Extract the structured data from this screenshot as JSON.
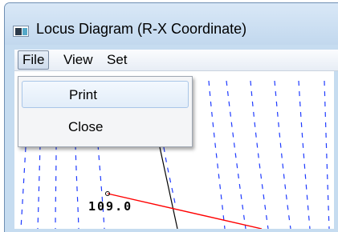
{
  "window": {
    "title": "Locus Diagram (R-X Coordinate)"
  },
  "icons": {
    "app": "app-icon"
  },
  "menubar": {
    "items": [
      {
        "label": "File",
        "active": true
      },
      {
        "label": "View",
        "active": false
      },
      {
        "label": "Set",
        "active": false
      }
    ]
  },
  "file_menu": {
    "items": [
      {
        "label": "Print",
        "highlighted": true
      },
      {
        "label": "Close",
        "highlighted": false
      }
    ]
  },
  "diagram": {
    "readout": "109.0",
    "colors": {
      "grid": "#1f3bff",
      "locus": "#ff0000",
      "axis": "#000000"
    }
  }
}
